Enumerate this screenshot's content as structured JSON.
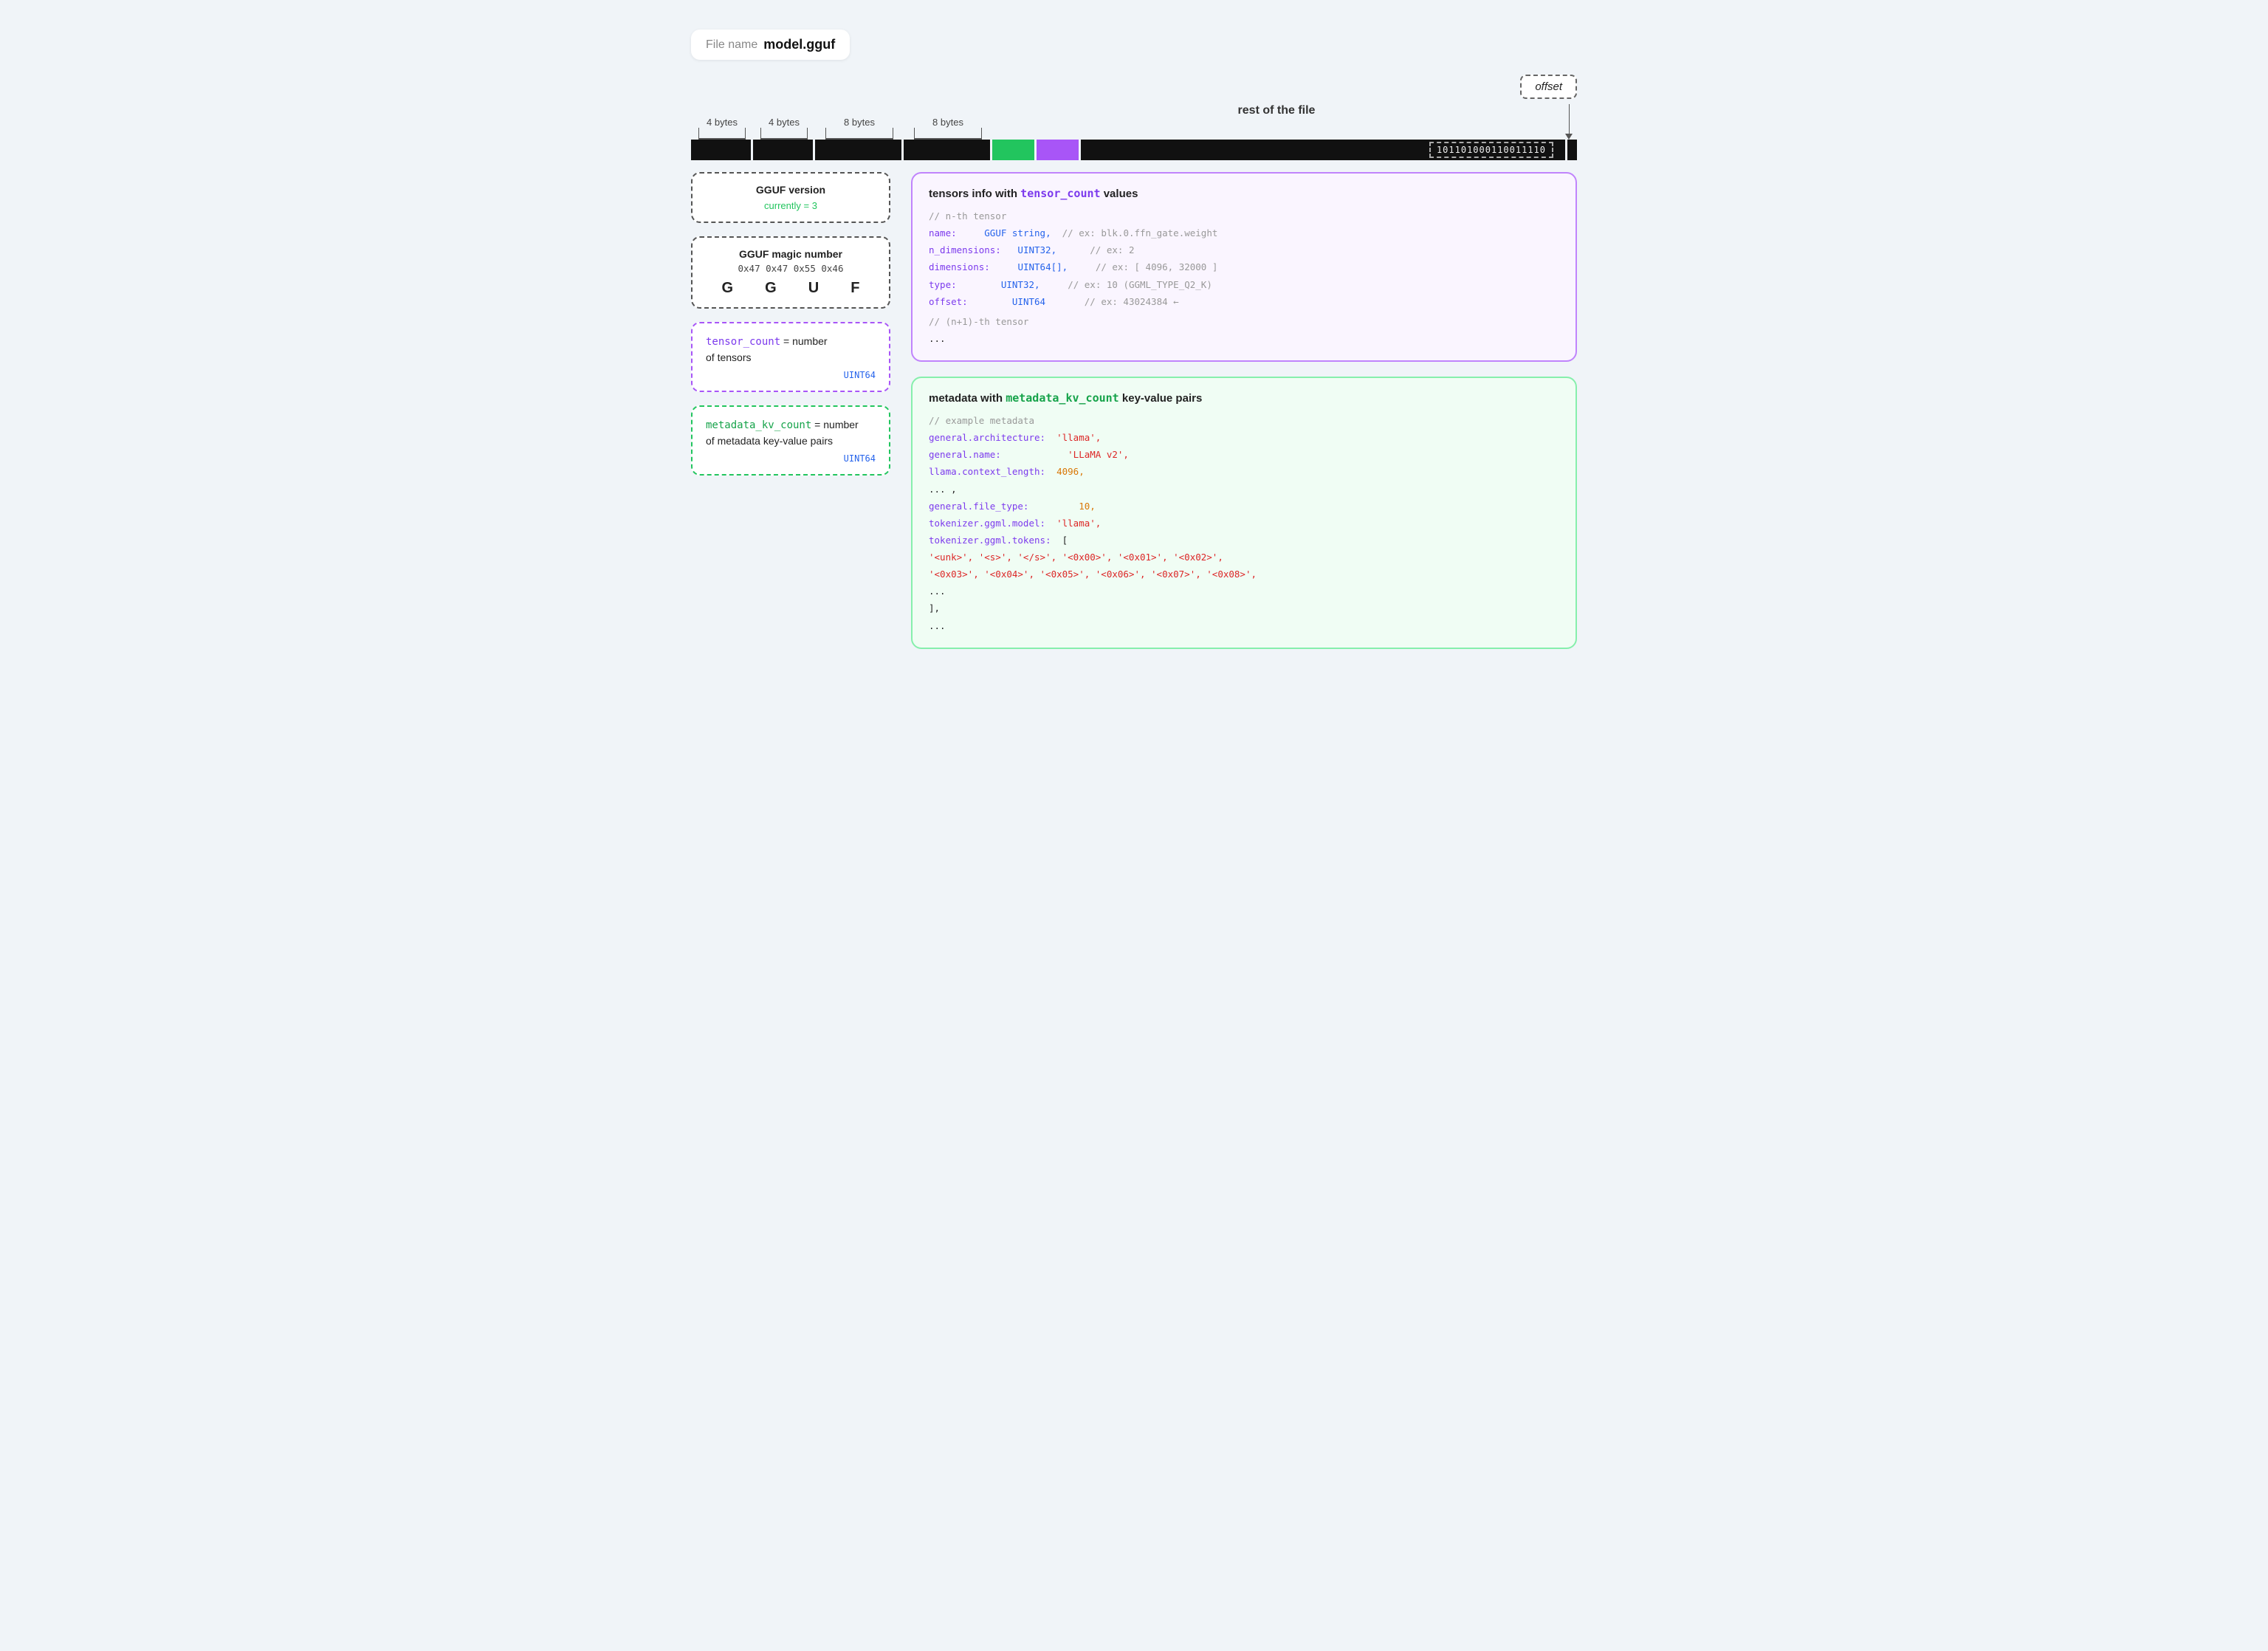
{
  "filename_label": "File name",
  "filename_value": "model.gguf",
  "byte_labels": [
    "4 bytes",
    "4 bytes",
    "8 bytes",
    "8 bytes"
  ],
  "rest_label": "rest of the file",
  "binary_value": "101101000110011110",
  "offset_label": "offset",
  "magic_box": {
    "title": "GGUF magic number",
    "hex": "0x47 0x47 0x55 0x46",
    "letters": [
      "G",
      "G",
      "U",
      "F"
    ]
  },
  "version_box": {
    "title": "GGUF version",
    "sub": "currently = 3"
  },
  "tensor_count_box": {
    "label1": "tensor_count",
    "label2": " = number",
    "label3": "of tensors",
    "type": "UINT64"
  },
  "metadata_kv_count_box": {
    "label1": "metadata_kv_count",
    "label2": " = number",
    "label3": "of metadata key-value pairs",
    "type": "UINT64"
  },
  "tensors_box": {
    "title_plain": "tensors info with ",
    "title_code": "tensor_count",
    "title_suffix": " values",
    "comment1": "// n-th tensor",
    "fields": [
      {
        "key": "name:",
        "type": "GGUF string,",
        "comment": "// ex: blk.0.ffn_gate.weight"
      },
      {
        "key": "n_dimensions:",
        "type": "UINT32,",
        "comment": "// ex: 2"
      },
      {
        "key": "dimensions:",
        "type": "UINT64[],",
        "comment": "// ex: [ 4096, 32000 ]"
      },
      {
        "key": "type:",
        "type": "UINT32,",
        "comment": "// ex: 10 (GGML_TYPE_Q2_K)"
      },
      {
        "key": "offset:",
        "type": "UINT64",
        "comment": "// ex: 43024384 ←"
      }
    ],
    "comment2": "// (n+1)-th tensor",
    "ellipsis": "..."
  },
  "metadata_box": {
    "title_plain": "metadata with ",
    "title_code": "metadata_kv_count",
    "title_suffix": " key-value pairs",
    "comment1": "// example metadata",
    "lines": [
      {
        "key": "general.architecture:",
        "value": "'llama',"
      },
      {
        "key": "general.name:",
        "value": "'LLaMA v2',"
      },
      {
        "key": "llama.context_length:",
        "value": "4096,"
      },
      {
        "key": "... ,",
        "value": ""
      },
      {
        "key": "general.file_type:",
        "value": "10,"
      },
      {
        "key": "tokenizer.ggml.model:",
        "value": "'llama',"
      },
      {
        "key": "tokenizer.ggml.tokens:",
        "value": "["
      }
    ],
    "tokens_line1": "  '<unk>',  '<s>',    '</s>',   '<0x00>', '<0x01>', '<0x02>',",
    "tokens_line2": "  '<0x03>', '<0x04>', '<0x05>', '<0x06>', '<0x07>', '<0x08>',",
    "tokens_ellipsis": "  ...",
    "close_bracket": "],",
    "final_ellipsis": "..."
  }
}
